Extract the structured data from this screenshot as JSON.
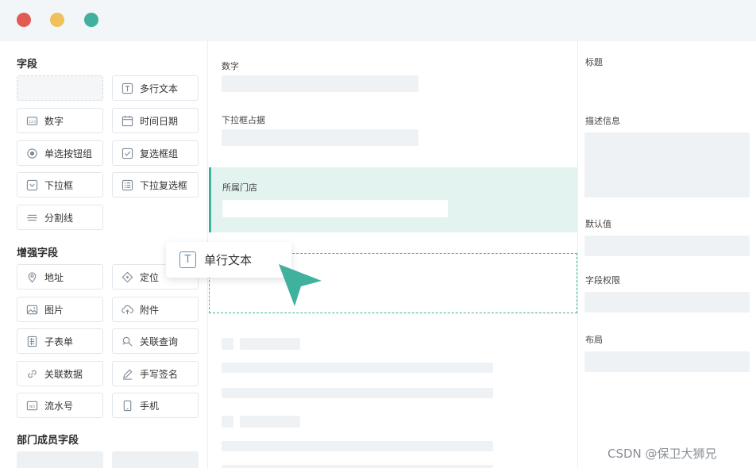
{
  "window": {
    "controls": [
      "close",
      "minimize",
      "maximize"
    ]
  },
  "left": {
    "section_fields": "字段",
    "section_enhanced": "增强字段",
    "section_dept": "部门成员字段",
    "fields": {
      "multiline_text": "多行文本",
      "number": "数字",
      "datetime": "时间日期",
      "radio_group": "单选按钮组",
      "checkbox_group": "复选框组",
      "dropdown": "下拉框",
      "multi_dropdown": "下拉复选框",
      "divider": "分割线"
    },
    "enhanced": {
      "address": "地址",
      "location": "定位",
      "image": "图片",
      "attachment": "附件",
      "subform": "子表单",
      "linked_query": "关联查询",
      "linked_data": "关联数据",
      "signature": "手写签名",
      "serial_number": "流水号",
      "phone": "手机"
    }
  },
  "center": {
    "field_number": "数字",
    "field_dropdown_placeholder": "下拉框占据",
    "field_store": "所属门店"
  },
  "drag": {
    "label": "单行文本"
  },
  "right": {
    "title": "标题",
    "description": "描述信息",
    "default_value": "默认值",
    "permission": "字段权限",
    "layout": "布局"
  },
  "colors": {
    "accent": "#3fb19d",
    "selected_bg": "#e3f3ef",
    "close": "#e25b52",
    "minimize": "#f0c15b",
    "maximize": "#3fb19d"
  },
  "watermark": "CSDN @保卫大狮兄"
}
